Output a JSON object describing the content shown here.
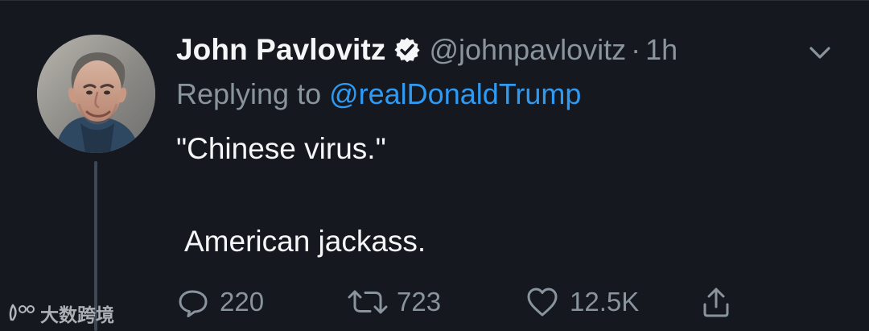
{
  "tweet": {
    "author": {
      "display_name": "John Pavlovitz",
      "handle": "@johnpavlovitz",
      "verified_icon": "verified-badge-icon"
    },
    "separator": "·",
    "time": "1h",
    "replying_prefix": "Replying to ",
    "replying_to": "@realDonaldTrump",
    "text_lines": [
      "\"Chinese virus.\"",
      "American jackass."
    ],
    "actions": {
      "reply_count": "220",
      "retweet_count": "723",
      "like_count": "12.5K"
    }
  },
  "watermark": {
    "text": "大数跨境"
  },
  "colors": {
    "background": "#15181f",
    "primary_text": "#f4f6f8",
    "secondary_text": "#8a949d",
    "link": "#2f9af2",
    "thread_line": "#3d4854"
  }
}
